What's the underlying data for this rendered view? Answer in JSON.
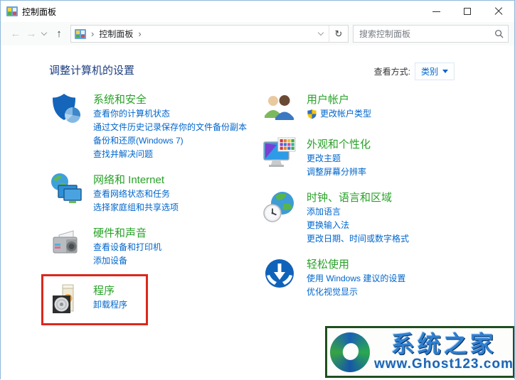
{
  "window": {
    "title": "控制面板"
  },
  "nav": {
    "back_icon": "←",
    "forward_icon": "→",
    "up_icon": "↑",
    "refresh_icon": "↻",
    "crumb_sep": "›",
    "breadcrumb": "控制面板",
    "search_placeholder": "搜索控制面板"
  },
  "header": {
    "title": "调整计算机的设置",
    "view_label": "查看方式:",
    "view_value": "类别"
  },
  "categories": {
    "left": [
      {
        "title": "系统和安全",
        "links": [
          "查看你的计算机状态",
          "通过文件历史记录保存你的文件备份副本",
          "备份和还原(Windows 7)",
          "查找并解决问题"
        ]
      },
      {
        "title": "网络和 Internet",
        "links": [
          "查看网络状态和任务",
          "选择家庭组和共享选项"
        ]
      },
      {
        "title": "硬件和声音",
        "links": [
          "查看设备和打印机",
          "添加设备"
        ]
      },
      {
        "title": "程序",
        "links": [
          "卸载程序"
        ],
        "highlighted": true
      }
    ],
    "right": [
      {
        "title": "用户帐户",
        "links": [
          "更改帐户类型"
        ]
      },
      {
        "title": "外观和个性化",
        "links": [
          "更改主题",
          "调整屏幕分辨率"
        ]
      },
      {
        "title": "时钟、语言和区域",
        "links": [
          "添加语言",
          "更换输入法",
          "更改日期、时间或数字格式"
        ]
      },
      {
        "title": "轻松使用",
        "links": [
          "使用 Windows 建议的设置",
          "优化视觉显示"
        ]
      }
    ]
  },
  "watermark": {
    "title": "系统之家",
    "url": "www.Ghost123.com"
  },
  "colors": {
    "category_green": "#28a228",
    "link_blue": "#0066cc",
    "heading_navy": "#1d3e81",
    "highlight_red": "#da281e",
    "window_border": "#8fb8dc"
  }
}
